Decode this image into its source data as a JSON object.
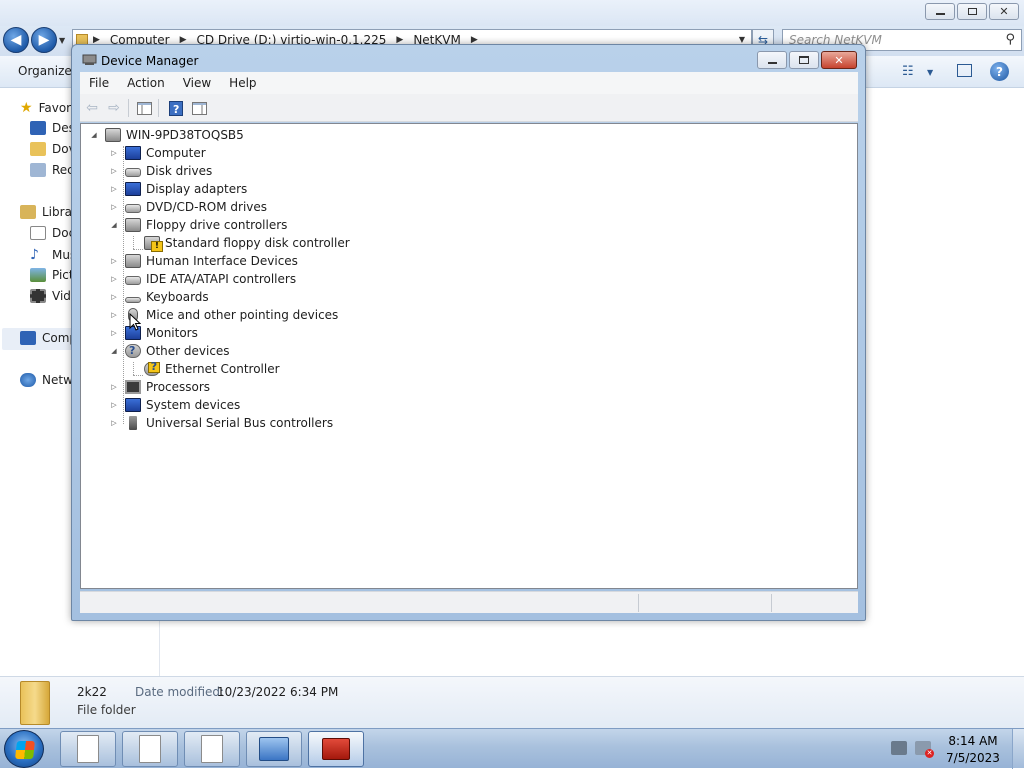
{
  "explorer": {
    "breadcrumb": [
      "Computer",
      "CD Drive (D:) virtio-win-0.1.225",
      "NetKVM"
    ],
    "search_placeholder": "Search NetKVM",
    "toolbar": {
      "organize": "Organize"
    },
    "nav_items": [
      {
        "label": "Favor",
        "icon": "star-icon"
      },
      {
        "label": "Des",
        "icon": "desktop-icon"
      },
      {
        "label": "Dov",
        "icon": "downloads-icon"
      },
      {
        "label": "Rec",
        "icon": "recent-places-icon"
      },
      {
        "label": "Librar",
        "icon": "libraries-icon"
      },
      {
        "label": "Doc",
        "icon": "documents-icon"
      },
      {
        "label": "Mus",
        "icon": "music-icon"
      },
      {
        "label": "Pict",
        "icon": "pictures-icon"
      },
      {
        "label": "Vide",
        "icon": "videos-icon"
      },
      {
        "label": "Comp",
        "icon": "computer-icon"
      },
      {
        "label": "Netw",
        "icon": "network-icon"
      }
    ],
    "details": {
      "name": "2k22",
      "date_label": "Date modified:",
      "date": "10/23/2022 6:34 PM",
      "type": "File folder"
    }
  },
  "device_manager": {
    "title": "Device Manager",
    "menu": [
      "File",
      "Action",
      "View",
      "Help"
    ],
    "root": "WIN-9PD38TOQSB5",
    "categories": [
      {
        "label": "Computer",
        "expanded": false,
        "icon": "computer-icon"
      },
      {
        "label": "Disk drives",
        "expanded": false,
        "icon": "disk-drive-icon"
      },
      {
        "label": "Display adapters",
        "expanded": false,
        "icon": "display-adapter-icon"
      },
      {
        "label": "DVD/CD-ROM drives",
        "expanded": false,
        "icon": "dvd-drive-icon"
      },
      {
        "label": "Floppy drive controllers",
        "expanded": true,
        "icon": "floppy-controller-icon",
        "children": [
          {
            "label": "Standard floppy disk controller",
            "warning": true
          }
        ]
      },
      {
        "label": "Human Interface Devices",
        "expanded": false,
        "icon": "hid-icon"
      },
      {
        "label": "IDE ATA/ATAPI controllers",
        "expanded": false,
        "icon": "ide-controller-icon"
      },
      {
        "label": "Keyboards",
        "expanded": false,
        "icon": "keyboard-icon"
      },
      {
        "label": "Mice and other pointing devices",
        "expanded": false,
        "icon": "mouse-icon"
      },
      {
        "label": "Monitors",
        "expanded": false,
        "icon": "monitor-icon"
      },
      {
        "label": "Other devices",
        "expanded": true,
        "icon": "unknown-device-icon",
        "children": [
          {
            "label": "Ethernet Controller",
            "warning": true
          }
        ]
      },
      {
        "label": "Processors",
        "expanded": false,
        "icon": "processor-icon"
      },
      {
        "label": "System devices",
        "expanded": false,
        "icon": "system-devices-icon"
      },
      {
        "label": "Universal Serial Bus controllers",
        "expanded": false,
        "icon": "usb-icon"
      }
    ]
  },
  "taskbar": {
    "time": "8:14 AM",
    "date": "7/5/2023",
    "buttons": [
      "file-icon",
      "file-icon",
      "file-icon",
      "control-panel-icon",
      "toolbox-icon"
    ]
  },
  "colors": {
    "title_gradient": "#b9d1ea",
    "warning": "#f5c518",
    "taskbar": "#a9c1dd"
  }
}
